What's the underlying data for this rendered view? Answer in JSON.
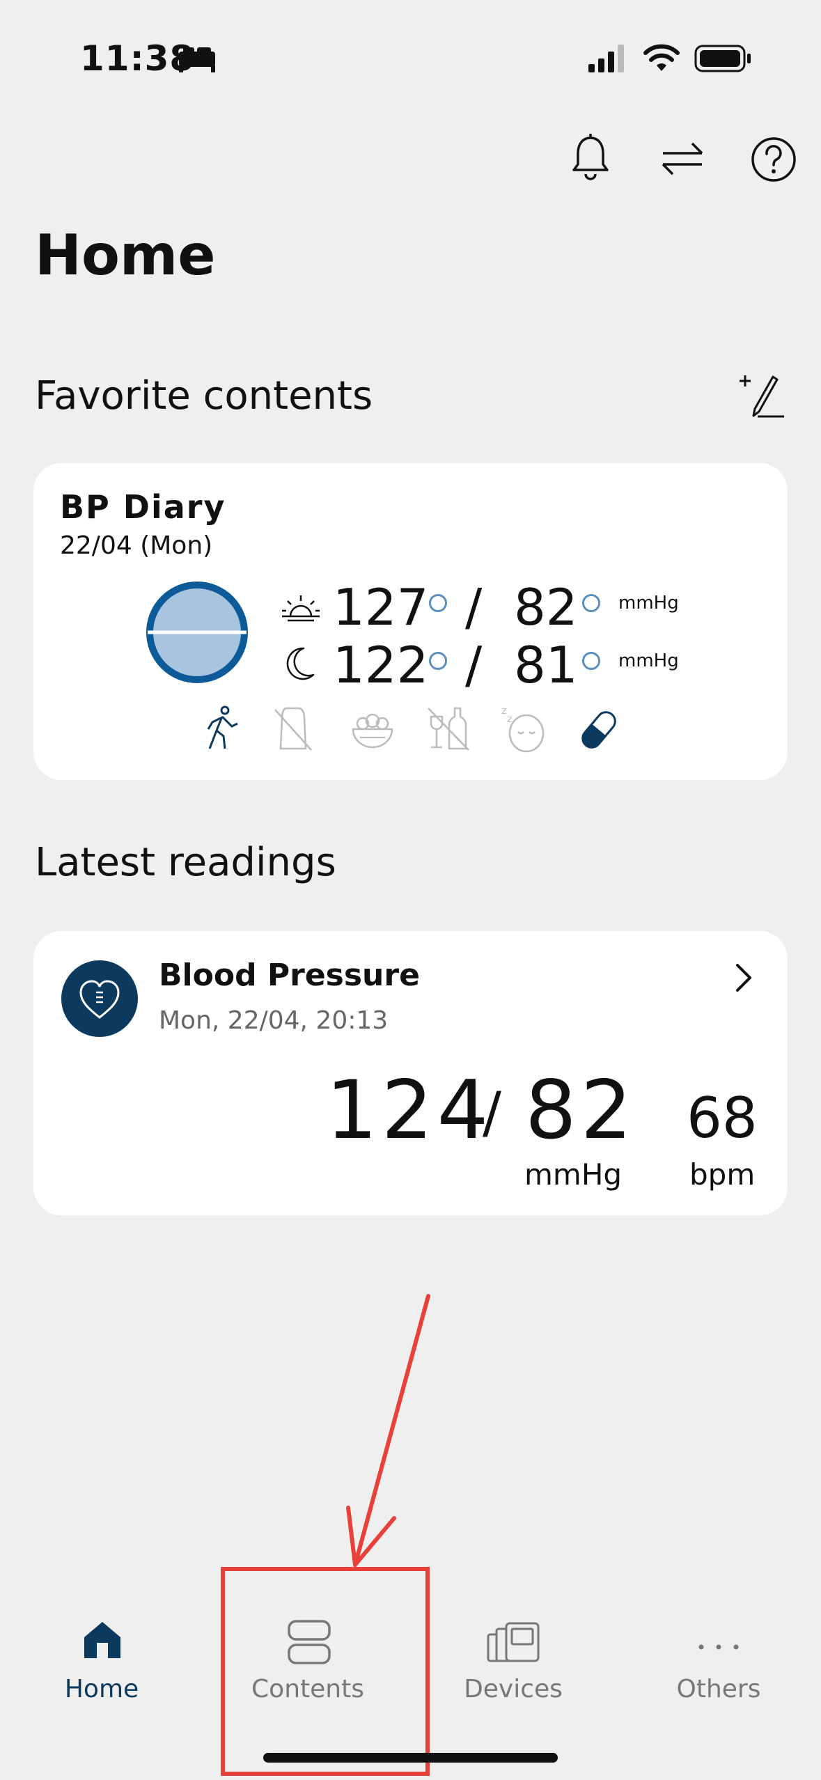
{
  "status_bar": {
    "time": "11:38"
  },
  "header": {
    "title": "Home"
  },
  "favorites": {
    "title": "Favorite contents",
    "card": {
      "title": "BP Diary",
      "date": "22/04 (Mon)",
      "morning": {
        "sys": "127",
        "sep": "/",
        "dia": "82",
        "unit": "mmHg"
      },
      "evening": {
        "sys": "122",
        "sep": "/",
        "dia": "81",
        "unit": "mmHg"
      }
    }
  },
  "latest": {
    "title": "Latest readings",
    "card": {
      "title": "Blood Pressure",
      "datetime": "Mon, 22/04, 20:13",
      "sys": "124",
      "sep": "/",
      "dia": "82",
      "pressure_unit": "mmHg",
      "pulse": "68",
      "pulse_unit": "bpm"
    }
  },
  "tabbar": {
    "items": [
      {
        "label": "Home",
        "icon": "home-icon",
        "active": true
      },
      {
        "label": "Contents",
        "icon": "contents-icon",
        "active": false
      },
      {
        "label": "Devices",
        "icon": "devices-icon",
        "active": false
      },
      {
        "label": "Others",
        "icon": "more-dots-icon",
        "active": false
      }
    ]
  },
  "colors": {
    "accent": "#0b3a5e",
    "circle_fill": "#a8c4de",
    "annotation": "#e8403a"
  }
}
